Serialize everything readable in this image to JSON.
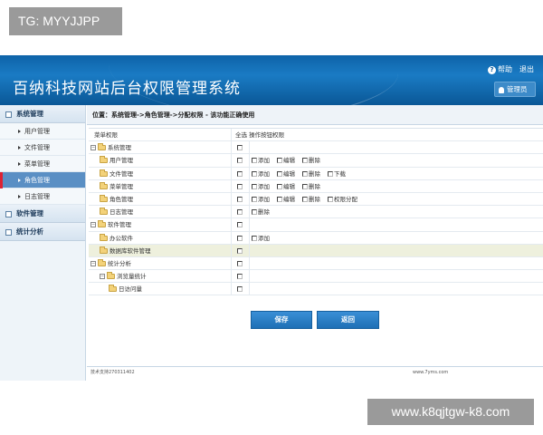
{
  "watermark": {
    "top_left": "TG: MYYJJPP",
    "bottom_right": "www.k8qjtgw-k8.com"
  },
  "header": {
    "title": "百纳科技网站后台权限管理系统",
    "help": "帮助",
    "logout": "退出",
    "admin": "管理员"
  },
  "sidebar": {
    "sections": [
      {
        "label": "系统管理",
        "items": [
          "用户管理",
          "文件管理",
          "菜单管理",
          "角色管理",
          "日志管理"
        ],
        "active": 3
      },
      {
        "label": "软件管理",
        "items": []
      },
      {
        "label": "统计分析",
        "items": []
      }
    ]
  },
  "breadcrumb": "位置：系统管理->角色管理->分配权限 - 该功能正确使用",
  "table": {
    "headers": {
      "name": "菜单权限",
      "perm": "全选 操作按钮权限"
    },
    "rows": [
      {
        "name": "系统管理",
        "level": 0,
        "perms": []
      },
      {
        "name": "用户管理",
        "level": 1,
        "perms": [
          "添加",
          "编辑",
          "删除"
        ]
      },
      {
        "name": "文件管理",
        "level": 1,
        "perms": [
          "添加",
          "编辑",
          "删除",
          "下载"
        ]
      },
      {
        "name": "菜单管理",
        "level": 1,
        "perms": [
          "添加",
          "编辑",
          "删除"
        ]
      },
      {
        "name": "角色管理",
        "level": 1,
        "perms": [
          "添加",
          "编辑",
          "删除",
          "权限分配"
        ]
      },
      {
        "name": "日志管理",
        "level": 1,
        "perms": [
          "删除"
        ]
      },
      {
        "name": "软件管理",
        "level": 0,
        "perms": []
      },
      {
        "name": "办公软件",
        "level": 1,
        "perms": [
          "添加"
        ]
      },
      {
        "name": "数据库软件管理",
        "level": 1,
        "perms": [],
        "highlight": true
      },
      {
        "name": "统计分析",
        "level": 0,
        "perms": []
      },
      {
        "name": "浏览量统计",
        "level": 1,
        "perms": []
      },
      {
        "name": "日访问量",
        "level": 2,
        "perms": []
      }
    ]
  },
  "buttons": {
    "save": "保存",
    "back": "返回"
  },
  "footer": {
    "left": "技术支持270311402",
    "right": "www.7yms.com"
  }
}
